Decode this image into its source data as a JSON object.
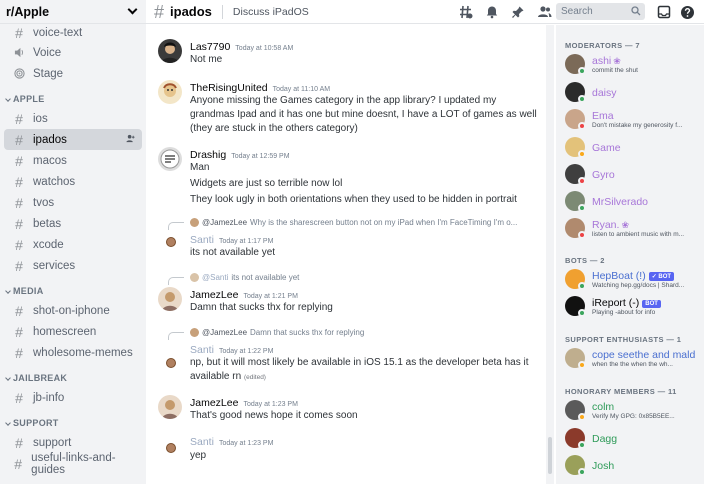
{
  "server": {
    "name": "r/Apple"
  },
  "sidebar": {
    "top_channels": [
      {
        "name": "voice-text",
        "icon": "hash-icon"
      },
      {
        "name": "Voice",
        "icon": "speaker-icon"
      },
      {
        "name": "Stage",
        "icon": "stage-icon"
      }
    ],
    "categories": [
      {
        "name": "APPLE",
        "channels": [
          "ios",
          "ipados",
          "macos",
          "watchos",
          "tvos",
          "betas",
          "xcode",
          "services"
        ]
      },
      {
        "name": "MEDIA",
        "channels": [
          "shot-on-iphone",
          "homescreen",
          "wholesome-memes"
        ]
      },
      {
        "name": "JAILBREAK",
        "channels": [
          "jb-info"
        ]
      },
      {
        "name": "SUPPORT",
        "channels": [
          "support",
          "useful-links-and-guides"
        ]
      }
    ],
    "active_channel": "ipados"
  },
  "topbar": {
    "channel": "ipados",
    "topic": "Discuss iPadOS",
    "search_placeholder": "Search",
    "icons": [
      "threads-icon",
      "bell-icon",
      "pin-icon",
      "members-icon",
      "search-icon",
      "inbox-icon",
      "help-icon"
    ]
  },
  "messages": [
    {
      "author": "Las7790",
      "timestamp": "Today at 10:58 AM",
      "lines": [
        "Not me"
      ]
    },
    {
      "author": "TheRisingUnited",
      "timestamp": "Today at 11:10 AM",
      "lines": [
        "Anyone missing the Games category in the app library? I updated my",
        "grandmas Ipad and it has one but mine doesnt, I have a LOT of games as well",
        "(they are stuck in the others category)"
      ]
    },
    {
      "author": "Drashig",
      "timestamp": "Today at 12:59 PM",
      "lines": [
        "Man",
        "Widgets are just so terrible now lol",
        "They look ugly in both orientations when they used to be hidden in portrait"
      ]
    },
    {
      "reply_to": "@JamezLee",
      "reply_text": "Why is the sharescreen button not on my iPad when I'm FaceTiming I'm o...",
      "author": "Santi",
      "timestamp": "Today at 1:17 PM",
      "lines": [
        "its not available yet"
      ]
    },
    {
      "reply_to": "@Santi",
      "reply_text": "its not available yet",
      "author": "JamezLee",
      "timestamp": "Today at 1:21 PM",
      "lines": [
        "Damn that sucks thx for replying"
      ]
    },
    {
      "reply_to": "@JamezLee",
      "reply_text": "Damn that sucks thx for replying",
      "author": "Santi",
      "timestamp": "Today at 1:22 PM",
      "lines": [
        "np, but it will most likely be available in iOS 15.1 as the developer beta has it",
        "available rn"
      ],
      "edited": "(edited)"
    },
    {
      "author": "JamezLee",
      "timestamp": "Today at 1:23 PM",
      "lines": [
        "That's good news hope it comes soon"
      ]
    },
    {
      "author": "Santi",
      "timestamp": "Today at 1:23 PM",
      "lines": [
        "yep"
      ]
    }
  ],
  "members": {
    "groups": [
      {
        "title": "MODERATORS — 7",
        "members": [
          {
            "name": "ashi",
            "status": "commit the shut",
            "color": "#a776d8",
            "badge": "❀"
          },
          {
            "name": "daisy",
            "status": "",
            "color": "#a776d8"
          },
          {
            "name": "Ema",
            "status": "Don't mistake my generosity f...",
            "color": "#a776d8"
          },
          {
            "name": "Game",
            "status": "",
            "color": "#a776d8"
          },
          {
            "name": "Gyro",
            "status": "",
            "color": "#a776d8"
          },
          {
            "name": "MrSilverado",
            "status": "",
            "color": "#a776d8"
          },
          {
            "name": "Ryan.",
            "status": "listen to ambient music with m...",
            "color": "#a776d8",
            "badge": "❀"
          }
        ]
      },
      {
        "title": "BOTS — 2",
        "members": [
          {
            "name": "HepBoat (!)",
            "status": "Watching hep.gg/docs | Shard...",
            "color": "#4a6fd0",
            "bot": "✓ BOT"
          },
          {
            "name": "iReport (-)",
            "status": "Playing -about for info",
            "color": "#060607",
            "bot": "BOT"
          }
        ]
      },
      {
        "title": "SUPPORT ENTHUSIASTS — 1",
        "members": [
          {
            "name": "cope seethe and mald",
            "status": "when the the when the wh...",
            "color": "#4a6fd0"
          }
        ]
      },
      {
        "title": "HONORARY MEMBERS — 11",
        "members": [
          {
            "name": "colm",
            "status": "Verify My GPG: 0x85B5EE...",
            "color": "#2f9b59"
          },
          {
            "name": "Dagg",
            "status": "",
            "color": "#2f9b59"
          },
          {
            "name": "Josh",
            "status": "",
            "color": "#2f9b59"
          }
        ]
      }
    ]
  }
}
